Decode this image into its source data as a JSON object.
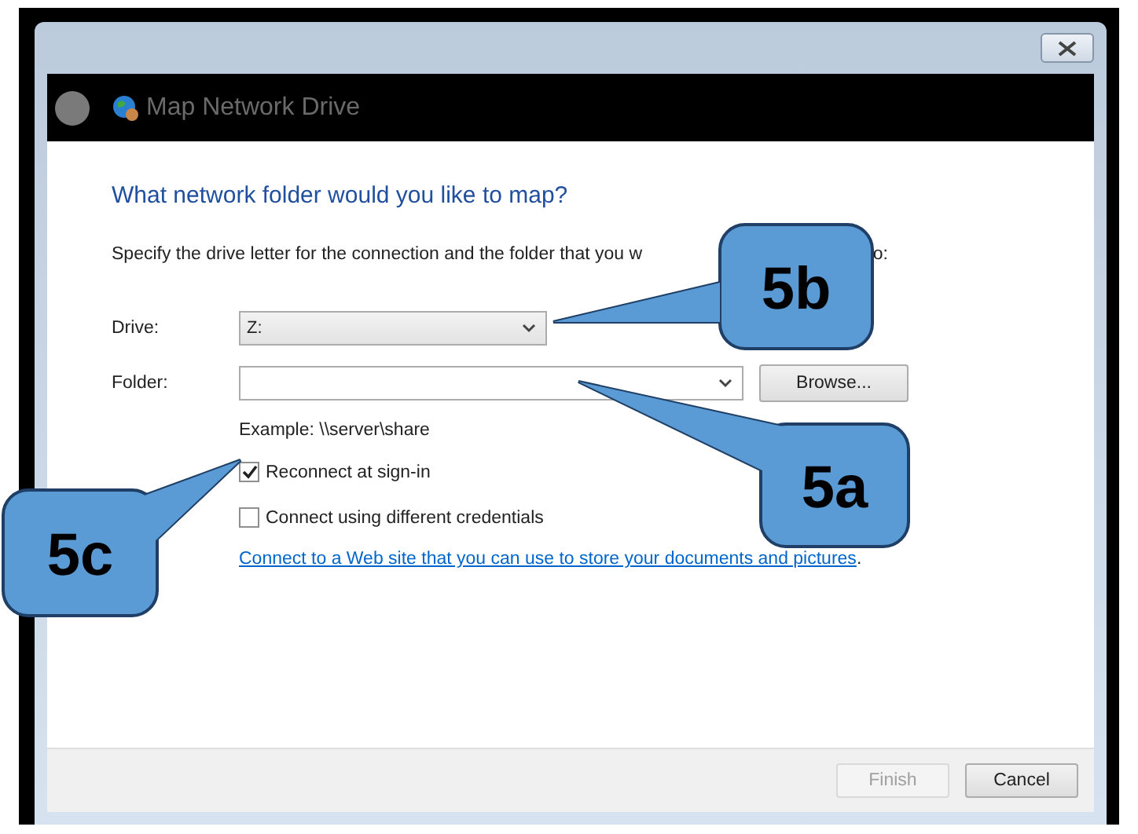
{
  "window": {
    "title": "Map Network Drive"
  },
  "heading": "What network folder would you like to map?",
  "description": {
    "before": "Specify the drive letter for the connection and the folder that you w",
    "after": "o:"
  },
  "drive": {
    "label": "Drive:",
    "value": "Z:"
  },
  "folder": {
    "label": "Folder:"
  },
  "browse_button": "Browse...",
  "example": "Example: \\\\server\\share",
  "options": [
    {
      "label": "Reconnect at sign-in",
      "checked": true
    },
    {
      "label": "Connect using different credentials",
      "checked": false
    }
  ],
  "link": {
    "text": "Connect to a Web site that you can use to store your documents and pictures",
    "trailing": "."
  },
  "buttons": [
    {
      "label": "Finish",
      "disabled": true
    },
    {
      "label": "Cancel",
      "disabled": false
    }
  ],
  "callouts": [
    {
      "label": "5b"
    },
    {
      "label": "5a"
    },
    {
      "label": "5c"
    }
  ]
}
